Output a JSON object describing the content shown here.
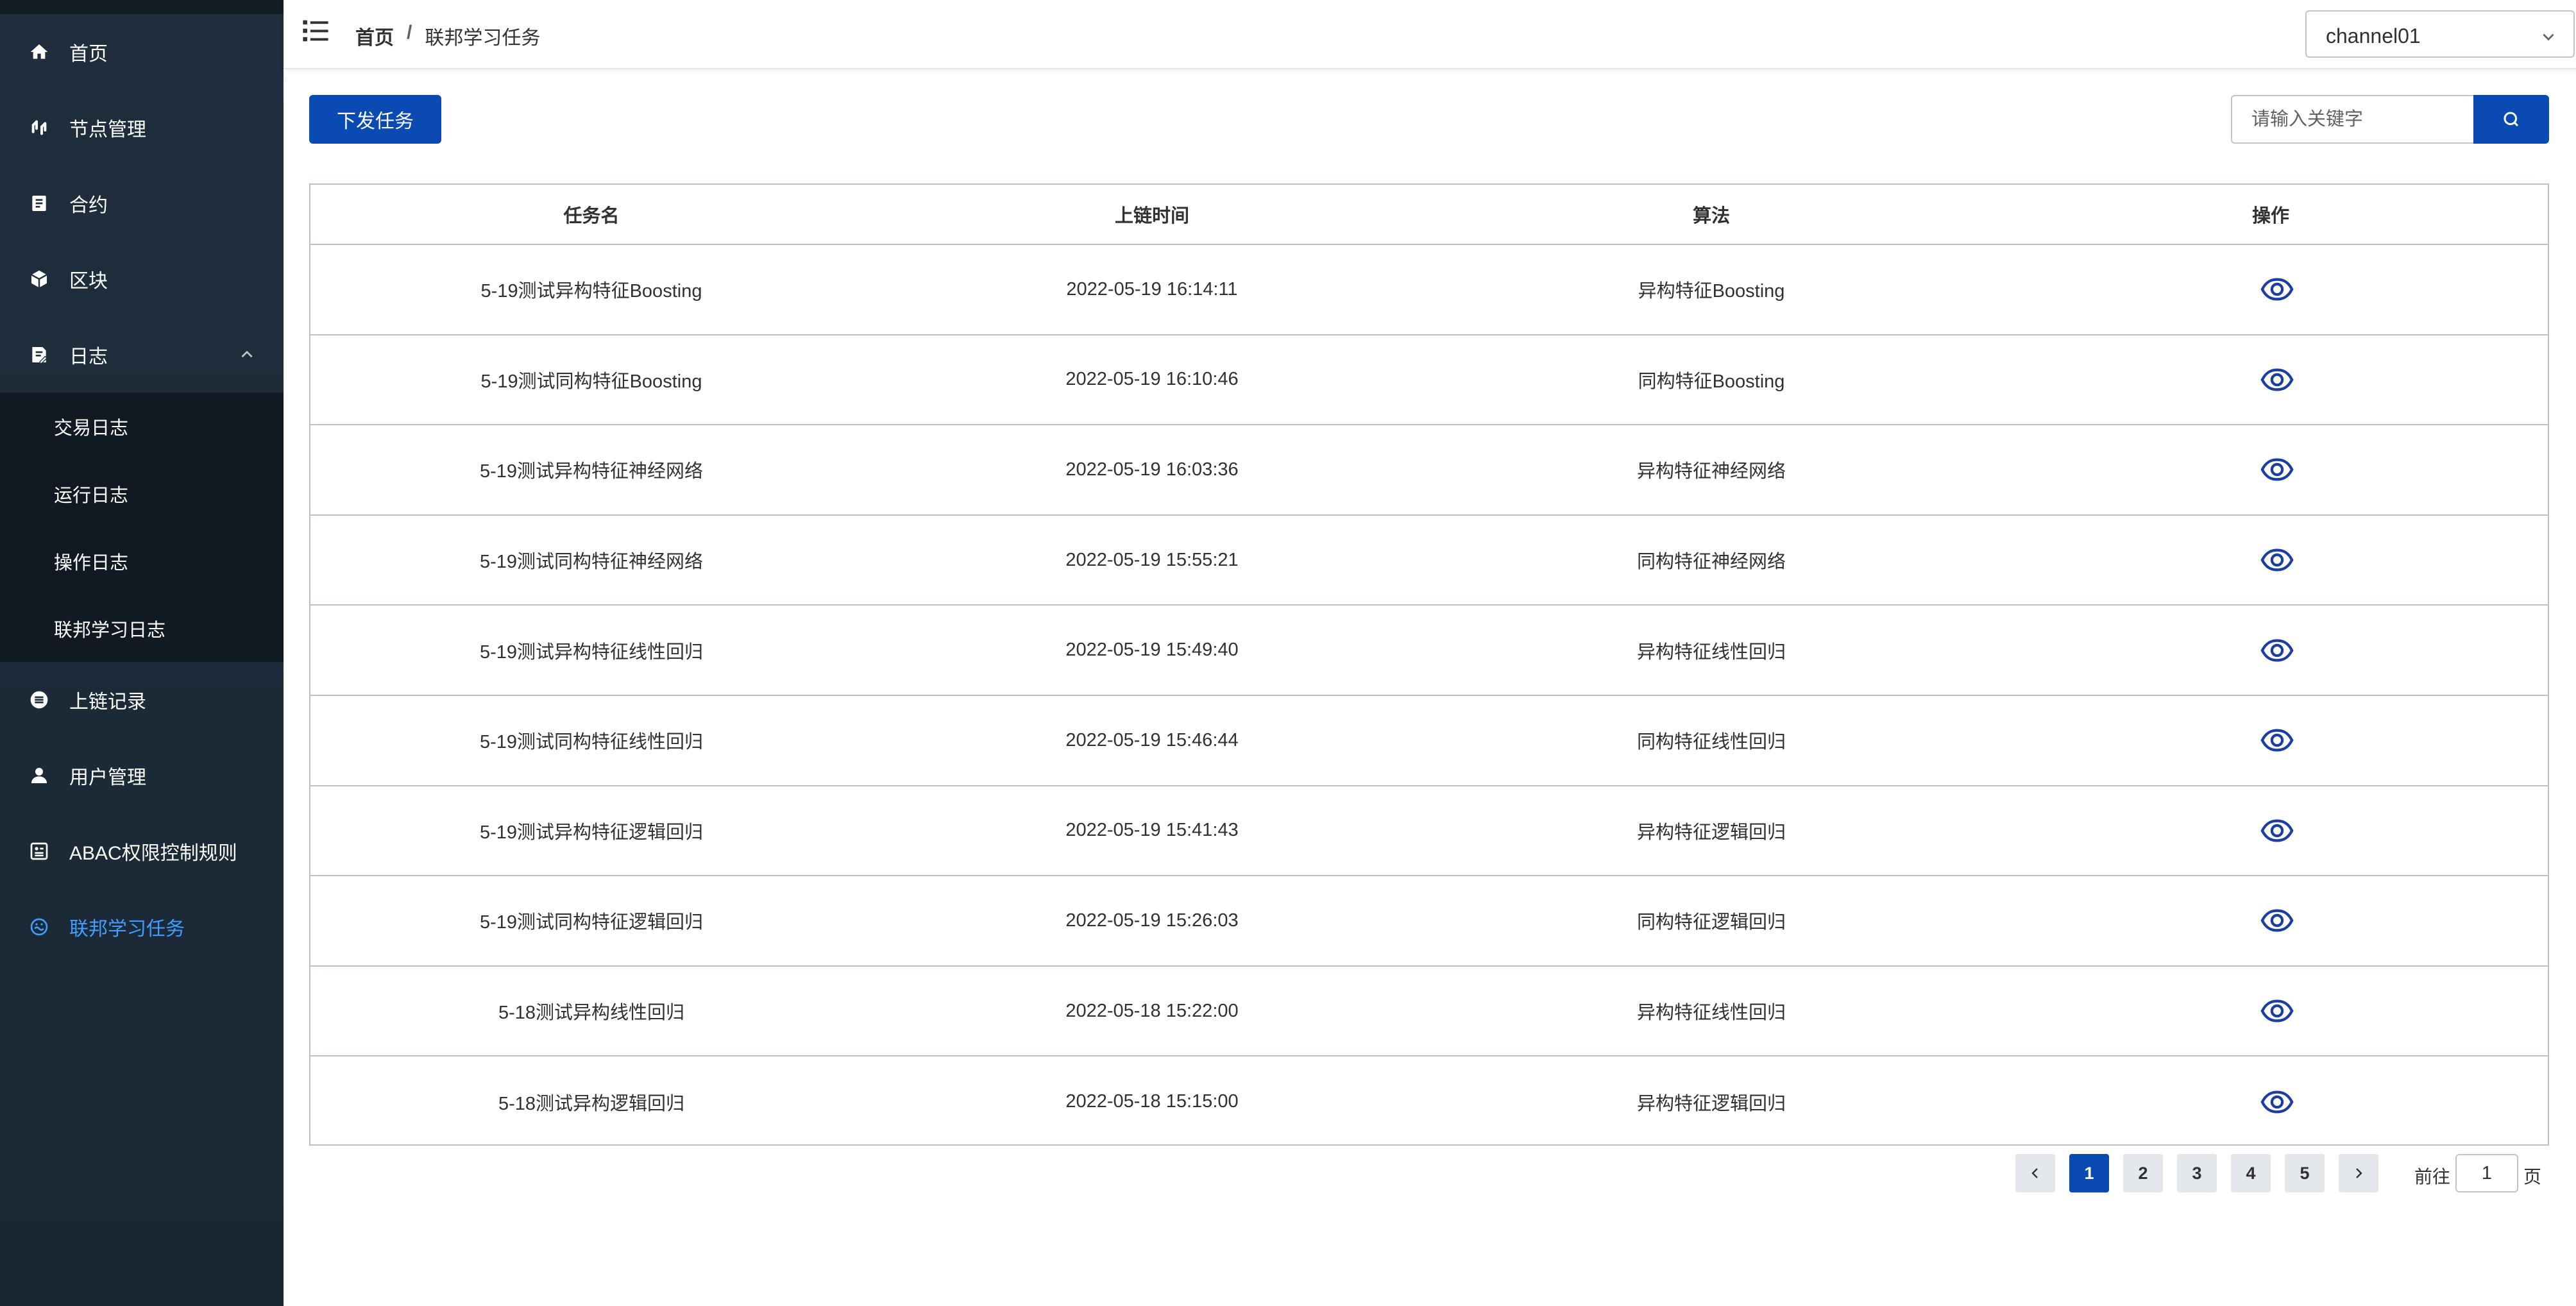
{
  "sidebar": {
    "items": [
      {
        "label": "首页",
        "icon": "home-icon"
      },
      {
        "label": "节点管理",
        "icon": "node-icon"
      },
      {
        "label": "合约",
        "icon": "contract-icon"
      },
      {
        "label": "区块",
        "icon": "block-icon"
      },
      {
        "label": "日志",
        "icon": "log-icon",
        "expanded": true
      },
      {
        "label": "上链记录",
        "icon": "chain-record-icon"
      },
      {
        "label": "用户管理",
        "icon": "user-icon"
      },
      {
        "label": "ABAC权限控制规则",
        "icon": "abac-icon"
      },
      {
        "label": "联邦学习任务",
        "icon": "federated-icon",
        "active": true
      }
    ],
    "log_submenu": [
      "交易日志",
      "运行日志",
      "操作日志",
      "联邦学习日志"
    ]
  },
  "header": {
    "breadcrumb_home": "首页",
    "breadcrumb_sep": "/",
    "breadcrumb_current": "联邦学习任务",
    "channel_value": "channel01"
  },
  "toolbar": {
    "issue_label": "下发任务",
    "search_placeholder": "请输入关键字"
  },
  "table": {
    "columns": [
      "任务名",
      "上链时间",
      "算法",
      "操作"
    ],
    "rows": [
      {
        "name": "5-19测试异构特征Boosting",
        "time": "2022-05-19 16:14:11",
        "algo": "异构特征Boosting"
      },
      {
        "name": "5-19测试同构特征Boosting",
        "time": "2022-05-19 16:10:46",
        "algo": "同构特征Boosting"
      },
      {
        "name": "5-19测试异构特征神经网络",
        "time": "2022-05-19 16:03:36",
        "algo": "异构特征神经网络"
      },
      {
        "name": "5-19测试同构特征神经网络",
        "time": "2022-05-19 15:55:21",
        "algo": "同构特征神经网络"
      },
      {
        "name": "5-19测试异构特征线性回归",
        "time": "2022-05-19 15:49:40",
        "algo": "异构特征线性回归"
      },
      {
        "name": "5-19测试同构特征线性回归",
        "time": "2022-05-19 15:46:44",
        "algo": "同构特征线性回归"
      },
      {
        "name": "5-19测试异构特征逻辑回归",
        "time": "2022-05-19 15:41:43",
        "algo": "异构特征逻辑回归"
      },
      {
        "name": "5-19测试同构特征逻辑回归",
        "time": "2022-05-19 15:26:03",
        "algo": "同构特征逻辑回归"
      },
      {
        "name": "5-18测试异构线性回归",
        "time": "2022-05-18 15:22:00",
        "algo": "异构特征线性回归"
      },
      {
        "name": "5-18测试异构逻辑回归",
        "time": "2022-05-18 15:15:00",
        "algo": "异构特征逻辑回归"
      }
    ]
  },
  "pagination": {
    "pages": [
      "1",
      "2",
      "3",
      "4",
      "5"
    ],
    "current": "1",
    "goto_prefix": "前往",
    "goto_value": "1",
    "goto_suffix": "页"
  },
  "colors": {
    "sidebar_bg": "#1f2d3d",
    "primary": "#0a4bb3",
    "active_menu": "#409eff",
    "eye_icon": "#1a3fa0"
  }
}
